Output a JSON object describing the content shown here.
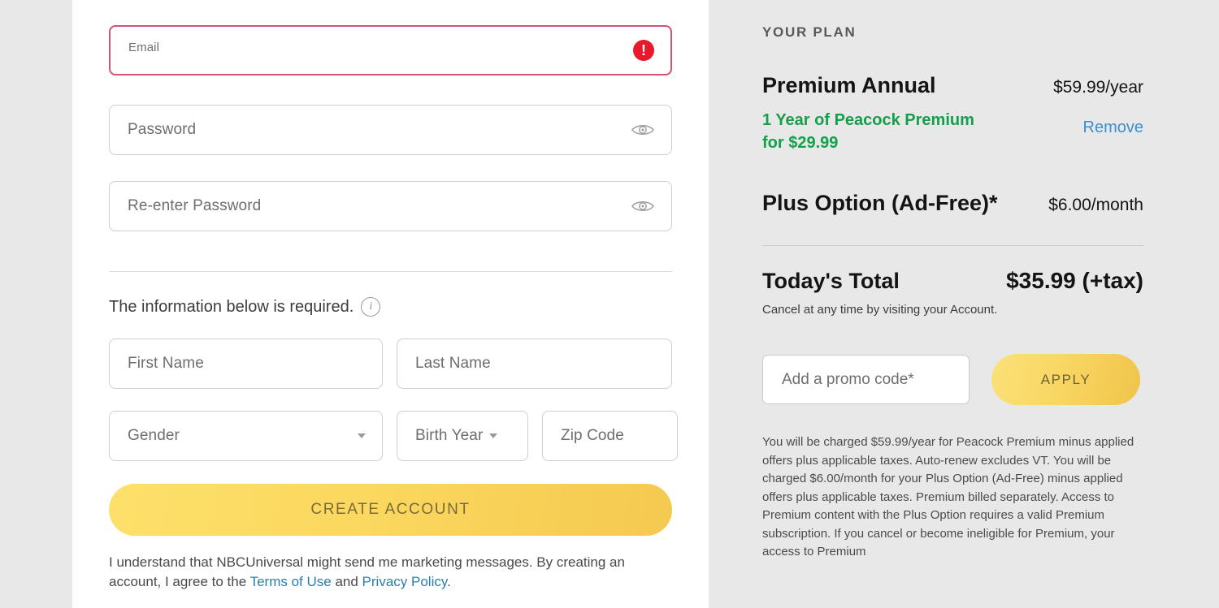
{
  "form": {
    "email": {
      "placeholder": "Email",
      "value": "",
      "error": true,
      "error_icon": "error-exclamation-icon"
    },
    "password": {
      "placeholder": "Password",
      "value": "",
      "reveal_icon": "eye-icon"
    },
    "reenter_password": {
      "placeholder": "Re-enter Password",
      "value": "",
      "reveal_icon": "eye-icon"
    },
    "required_notice": "The information below is required.",
    "info_icon": "i",
    "first_name": {
      "placeholder": "First Name",
      "value": ""
    },
    "last_name": {
      "placeholder": "Last Name",
      "value": ""
    },
    "gender": {
      "placeholder": "Gender",
      "value": ""
    },
    "birth_year": {
      "placeholder": "Birth Year",
      "value": ""
    },
    "zip_code": {
      "placeholder": "Zip Code",
      "value": ""
    },
    "submit_label": "CREATE ACCOUNT",
    "legal": {
      "part1": "I understand that NBCUniversal might send me marketing messages. By creating an account, I agree to the ",
      "terms_link": "Terms of Use",
      "conjunction": " and ",
      "privacy_link": "Privacy Policy",
      "period": "."
    }
  },
  "plan": {
    "heading": "YOUR PLAN",
    "name": "Premium Annual",
    "price": "$59.99/year",
    "offer": "1 Year of Peacock Premium for $29.99",
    "remove_label": "Remove",
    "addon_name": "Plus Option (Ad-Free)*",
    "addon_price": "$6.00/month",
    "total_label": "Today's Total",
    "total_value": "$35.99 (+tax)",
    "cancel_note": "Cancel at any time by visiting your Account.",
    "promo_placeholder": "Add a promo code*",
    "promo_value": "",
    "apply_label": "APPLY",
    "fineprint": "You will be charged $59.99/year for Peacock Premium minus applied offers plus applicable taxes. Auto-renew excludes VT. You will be charged $6.00/month for your Plus Option (Ad-Free) minus applied offers plus applicable taxes. Premium billed separately. Access to Premium content with the Plus Option requires a valid Premium subscription. If you cancel or become ineligible for Premium, your access to Premium"
  },
  "colors": {
    "error_red": "#d6536d",
    "error_badge": "#e8192c",
    "offer_green": "#14a04a",
    "link_blue": "#3a8fd0",
    "legal_link_blue": "#2a7fa8",
    "button_yellow": "#f8d662",
    "panel_bg": "#e8e8e8",
    "form_bg": "#ffffff"
  }
}
